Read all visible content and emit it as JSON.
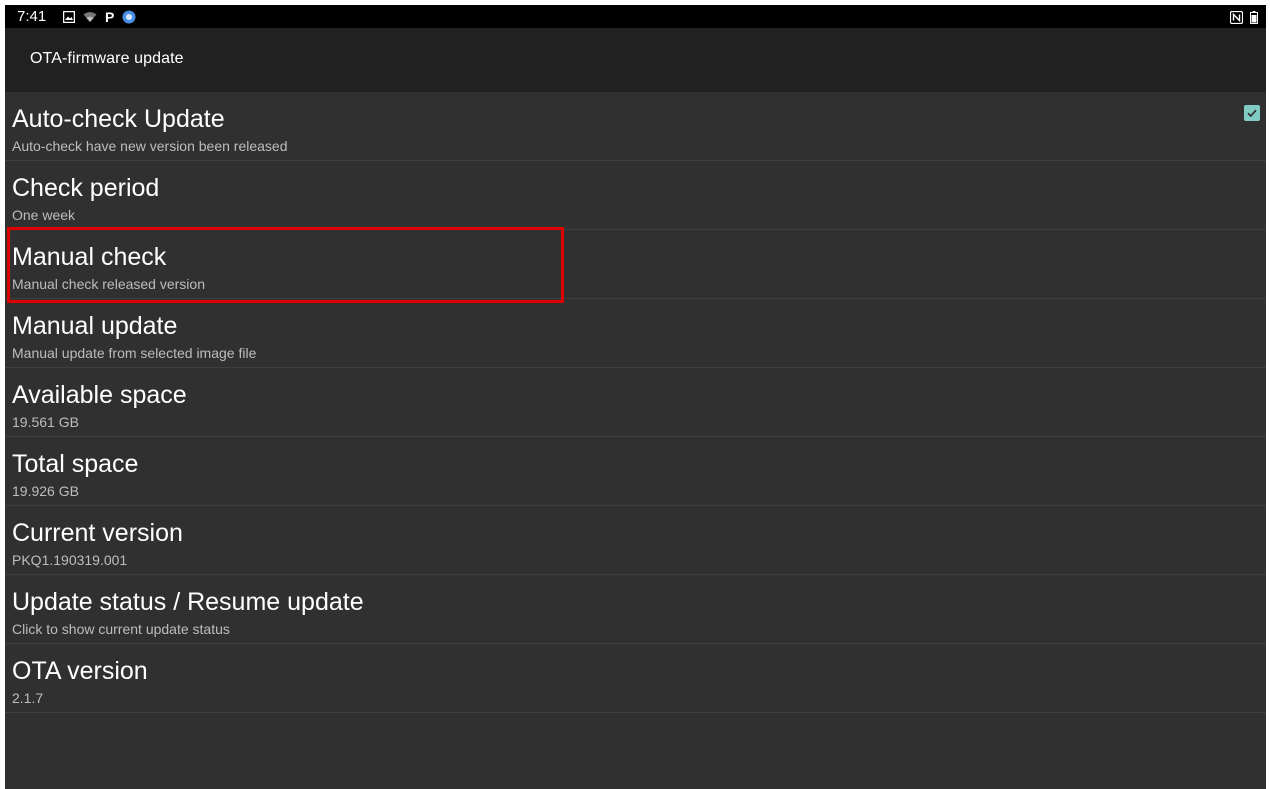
{
  "status_bar": {
    "time": "7:41",
    "left_icons": [
      "notification-image-icon",
      "wifi-icon",
      "parking-icon",
      "app-badge-icon"
    ],
    "right_icons": [
      "nfc-icon",
      "battery-icon"
    ]
  },
  "app_bar": {
    "title": "OTA-firmware update"
  },
  "preferences": [
    {
      "id": "auto-check-update",
      "title": "Auto-check Update",
      "summary": "Auto-check have new version been released",
      "checked": true
    },
    {
      "id": "check-period",
      "title": "Check period",
      "summary": "One week"
    },
    {
      "id": "manual-check",
      "title": "Manual check",
      "summary": "Manual check released version",
      "highlighted": true
    },
    {
      "id": "manual-update",
      "title": "Manual update",
      "summary": "Manual update from selected image file"
    },
    {
      "id": "available-space",
      "title": "Available space",
      "summary": "19.561 GB"
    },
    {
      "id": "total-space",
      "title": "Total space",
      "summary": "19.926 GB"
    },
    {
      "id": "current-version",
      "title": "Current version",
      "summary": "PKQ1.190319.001"
    },
    {
      "id": "update-status",
      "title": "Update status / Resume update",
      "summary": "Click to show current update status"
    },
    {
      "id": "ota-version",
      "title": "OTA version",
      "summary": "2.1.7"
    }
  ],
  "colors": {
    "background": "#303030",
    "app_bar": "#212121",
    "status_bar": "#000000",
    "checkbox_accent": "#80cbc4",
    "highlight": "#e00000"
  }
}
